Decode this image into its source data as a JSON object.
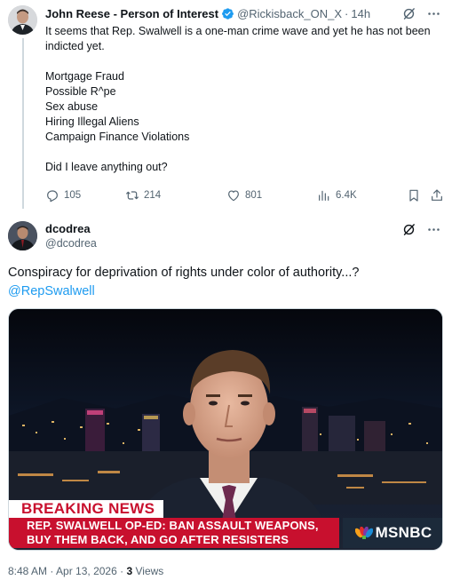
{
  "tweet1": {
    "author_name": "John Reese - Person of Interest",
    "handle": "@Rickisback_ON_X",
    "separator": "·",
    "time": "14h",
    "lines": [
      "It seems that Rep. Swalwell is a one-man crime wave and yet he has not been",
      "indicted yet.",
      "",
      "Mortgage Fraud",
      "Possible R^pe",
      "Sex abuse",
      "Hiring Illegal Aliens",
      "Campaign Finance Violations",
      "",
      "Did I leave anything out?"
    ],
    "stats": {
      "replies": "105",
      "reposts": "214",
      "likes": "801",
      "views": "6.4K"
    }
  },
  "tweet2": {
    "author_name": "dcodrea",
    "handle": "@dcodrea",
    "text": "Conspiracy for deprivation of rights under color of authority...?",
    "mention": "@RepSwalwell",
    "media": {
      "breaking_label": "BREAKING NEWS",
      "headline_line1": "REP. SWALWELL OP-ED: BAN ASSAULT WEAPONS,",
      "headline_line2": "BUY THEM BACK, AND GO AFTER RESISTERS",
      "network": "MSNBC"
    },
    "footer": {
      "time": "8:48 AM",
      "separator": "·",
      "date": "Apr 13, 2026",
      "views_count": "3",
      "views_label": "Views"
    }
  },
  "colors": {
    "accent": "#1d9bf0",
    "text": "#0f1419",
    "secondary": "#536471",
    "banner_red": "#c8102e"
  }
}
